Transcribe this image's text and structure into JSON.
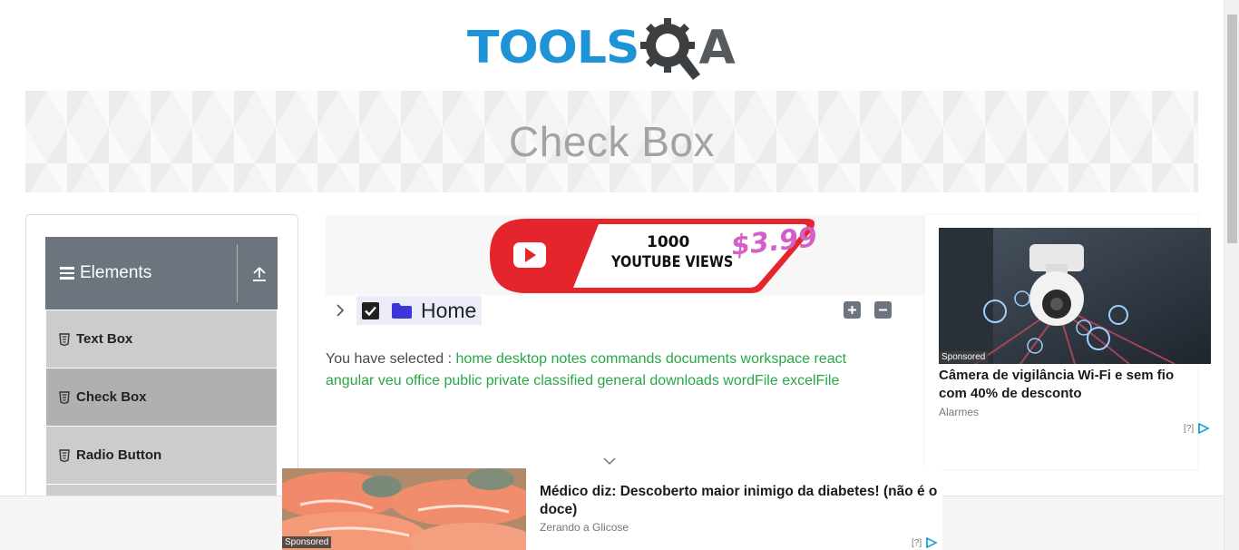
{
  "logo": {
    "part1": "TOOLS",
    "part2": "A"
  },
  "banner": {
    "title": "Check Box"
  },
  "sidebar": {
    "group_title": "Elements",
    "items": [
      {
        "label": "Text Box"
      },
      {
        "label": "Check Box",
        "active": true
      },
      {
        "label": "Radio Button"
      }
    ]
  },
  "top_ad": {
    "line1": "1000",
    "line2": "YOUTUBE VIEWS",
    "price": "$3.99"
  },
  "tree": {
    "root_label": "Home",
    "checked": true
  },
  "result": {
    "prefix": "You have selected :",
    "items": [
      "home",
      "desktop",
      "notes",
      "commands",
      "documents",
      "workspace",
      "react",
      "angular",
      "veu",
      "office",
      "public",
      "private",
      "classified",
      "general",
      "downloads",
      "wordFile",
      "excelFile"
    ]
  },
  "right_ad": {
    "sponsored": "Sponsored",
    "title": "Câmera de vigilância Wi-Fi e sem fio com 40% de desconto",
    "source": "Alarmes",
    "adchoice": "[?]"
  },
  "bottom_ad": {
    "sponsored": "Sponsored",
    "title": "Médico diz: Descoberto maior inimigo da diabetes! (não é o doce)",
    "source": "Zerando a Glicose",
    "adchoice": "[?]"
  },
  "colors": {
    "accent": "#1e93d6",
    "sidebar_header": "#6c757d",
    "selected_text": "#28a745",
    "youtube_red": "#e4262c"
  }
}
